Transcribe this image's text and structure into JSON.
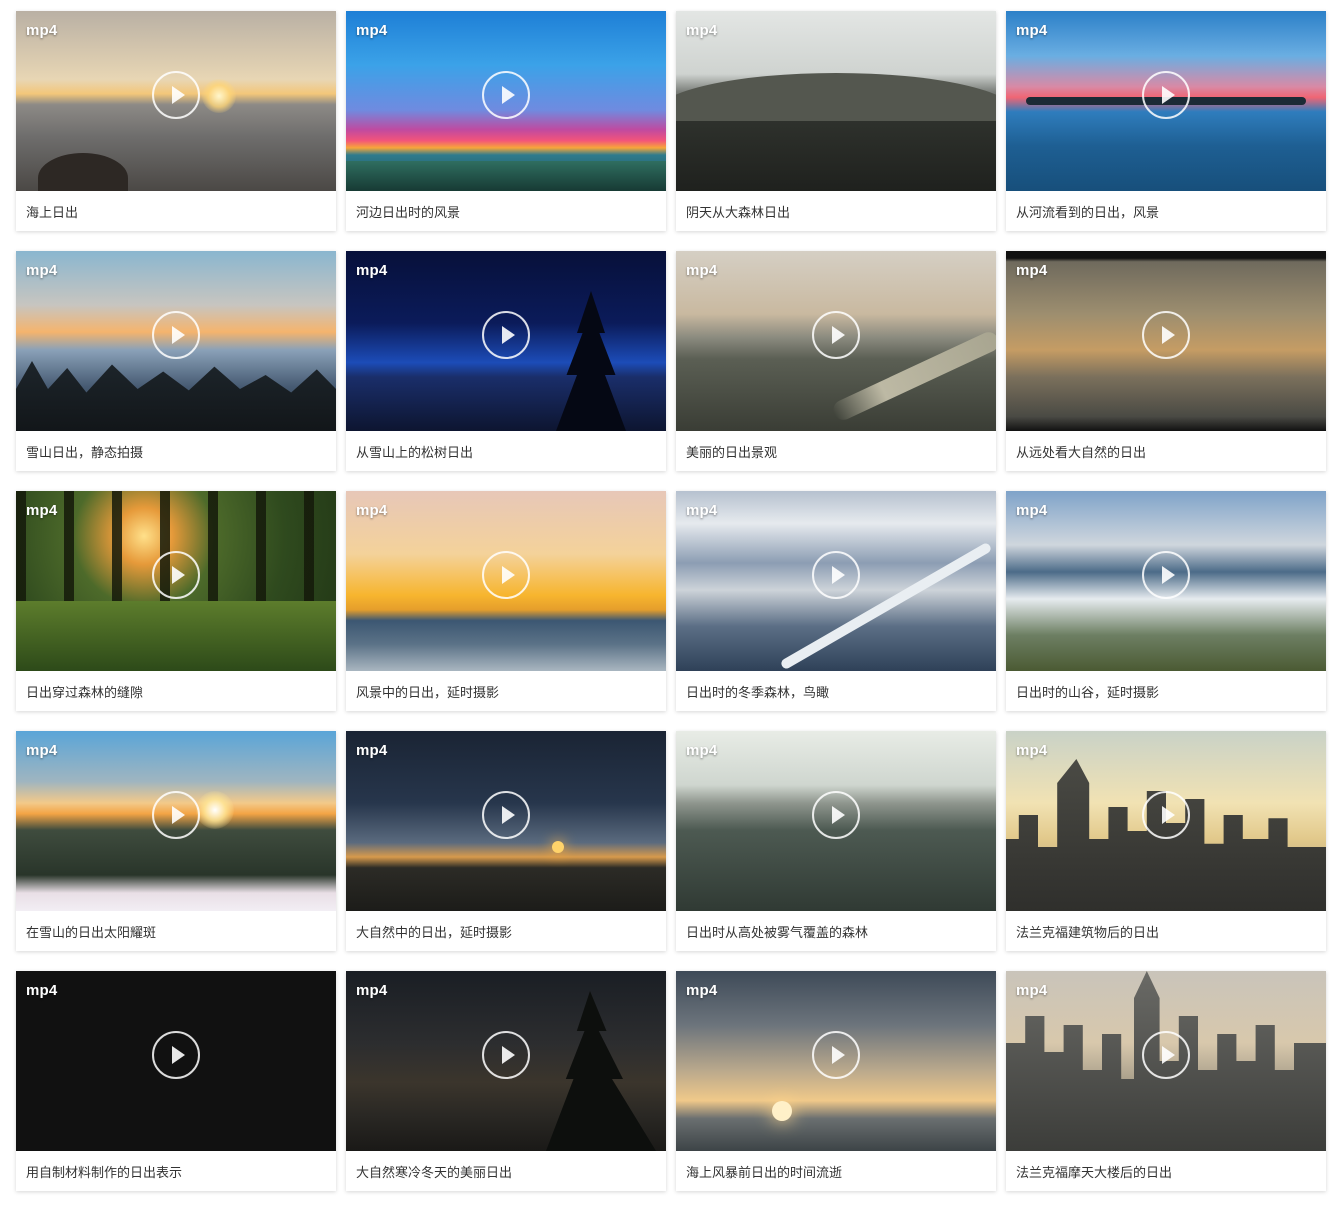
{
  "grid": {
    "items": [
      {
        "badge": "mp4",
        "title": "海上日出"
      },
      {
        "badge": "mp4",
        "title": "河边日出时的风景"
      },
      {
        "badge": "mp4",
        "title": "阴天从大森林日出"
      },
      {
        "badge": "mp4",
        "title": "从河流看到的日出，风景"
      },
      {
        "badge": "mp4",
        "title": "雪山日出，静态拍摄"
      },
      {
        "badge": "mp4",
        "title": "从雪山上的松树日出"
      },
      {
        "badge": "mp4",
        "title": "美丽的日出景观"
      },
      {
        "badge": "mp4",
        "title": "从远处看大自然的日出"
      },
      {
        "badge": "mp4",
        "title": "日出穿过森林的缝隙"
      },
      {
        "badge": "mp4",
        "title": "风景中的日出，延时摄影"
      },
      {
        "badge": "mp4",
        "title": "日出时的冬季森林，鸟瞰"
      },
      {
        "badge": "mp4",
        "title": "日出时的山谷，延时摄影"
      },
      {
        "badge": "mp4",
        "title": "在雪山的日出太阳耀斑"
      },
      {
        "badge": "mp4",
        "title": "大自然中的日出，延时摄影"
      },
      {
        "badge": "mp4",
        "title": "日出时从高处被雾气覆盖的森林"
      },
      {
        "badge": "mp4",
        "title": "法兰克福建筑物后的日出"
      },
      {
        "badge": "mp4",
        "title": "用自制材料制作的日出表示"
      },
      {
        "badge": "mp4",
        "title": "大自然寒冷冬天的美丽日出"
      },
      {
        "badge": "mp4",
        "title": "海上风暴前日出的时间流逝"
      },
      {
        "badge": "mp4",
        "title": "法兰克福摩天大楼后的日出"
      }
    ]
  },
  "icons": {
    "play": "play-circle-icon"
  },
  "colors": {
    "caption_text": "#333333",
    "badge_text": "#ffffff",
    "card_background": "#ffffff"
  }
}
